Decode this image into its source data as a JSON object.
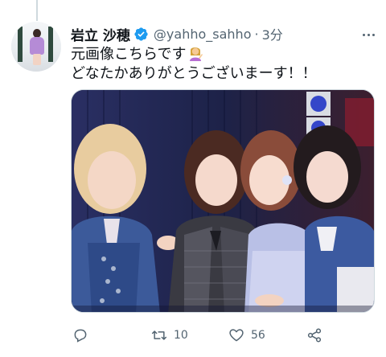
{
  "tweet": {
    "author": {
      "display_name": "岩立 沙穂",
      "handle": "@yahho_sahho",
      "verified": true
    },
    "separator": "·",
    "time": "3分",
    "text_lines": [
      "元画像こちらです",
      "どなたかありがとうございまーす！！"
    ],
    "emoji": "person-tipping-hand-emoji",
    "media": {
      "type": "photo"
    }
  },
  "actions": {
    "reply": {
      "icon": "reply-icon"
    },
    "retweet": {
      "icon": "retweet-icon",
      "count": "10"
    },
    "like": {
      "icon": "heart-icon",
      "count": "56"
    },
    "share": {
      "icon": "share-icon"
    }
  },
  "colors": {
    "text_primary": "#0f1419",
    "text_secondary": "#536471",
    "verified": "#1d9bf0",
    "thread_line": "#cfd9de"
  }
}
